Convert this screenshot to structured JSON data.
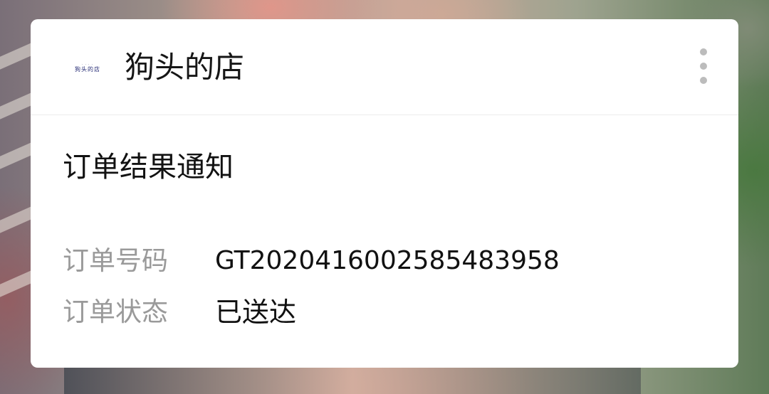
{
  "notification": {
    "shop_name": "狗头的店",
    "logo_text": "狗头的店",
    "menu_icon": "more-vertical-icon",
    "title": "订单结果通知",
    "fields": [
      {
        "label": "订单号码",
        "value": "GT2020416002585483958"
      },
      {
        "label": "订单状态",
        "value": "已送达"
      }
    ]
  }
}
